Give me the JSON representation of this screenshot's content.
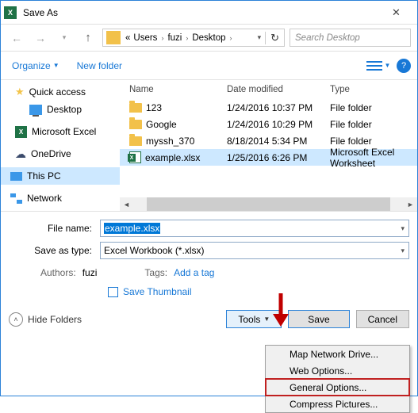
{
  "titlebar": {
    "title": "Save As"
  },
  "address": {
    "crumbs": [
      "Users",
      "fuzi",
      "Desktop"
    ]
  },
  "search": {
    "placeholder": "Search Desktop"
  },
  "toolbar": {
    "organize": "Organize",
    "newfolder": "New folder"
  },
  "sidebar": {
    "items": [
      {
        "label": "Quick access"
      },
      {
        "label": "Desktop"
      },
      {
        "label": "Microsoft Excel"
      },
      {
        "label": "OneDrive"
      },
      {
        "label": "This PC"
      },
      {
        "label": "Network"
      }
    ]
  },
  "columns": {
    "name": "Name",
    "date": "Date modified",
    "type": "Type"
  },
  "files": [
    {
      "name": "123",
      "date": "1/24/2016 10:37 PM",
      "type": "File folder"
    },
    {
      "name": "Google",
      "date": "1/24/2016 10:29 PM",
      "type": "File folder"
    },
    {
      "name": "myssh_370",
      "date": "8/18/2014 5:34 PM",
      "type": "File folder"
    },
    {
      "name": "example.xlsx",
      "date": "1/25/2016 6:26 PM",
      "type": "Microsoft Excel Worksheet"
    }
  ],
  "filename": {
    "label": "File name:",
    "value": "example.xlsx"
  },
  "filetype": {
    "label": "Save as type:",
    "value": "Excel Workbook (*.xlsx)"
  },
  "meta": {
    "authors_lbl": "Authors:",
    "authors_val": "fuzi",
    "tags_lbl": "Tags:",
    "tags_val": "Add a tag"
  },
  "thumb": {
    "label": "Save Thumbnail"
  },
  "footer": {
    "hide": "Hide Folders",
    "tools": "Tools",
    "save": "Save",
    "cancel": "Cancel"
  },
  "menu": {
    "items": [
      "Map Network Drive...",
      "Web Options...",
      "General Options...",
      "Compress Pictures..."
    ]
  }
}
